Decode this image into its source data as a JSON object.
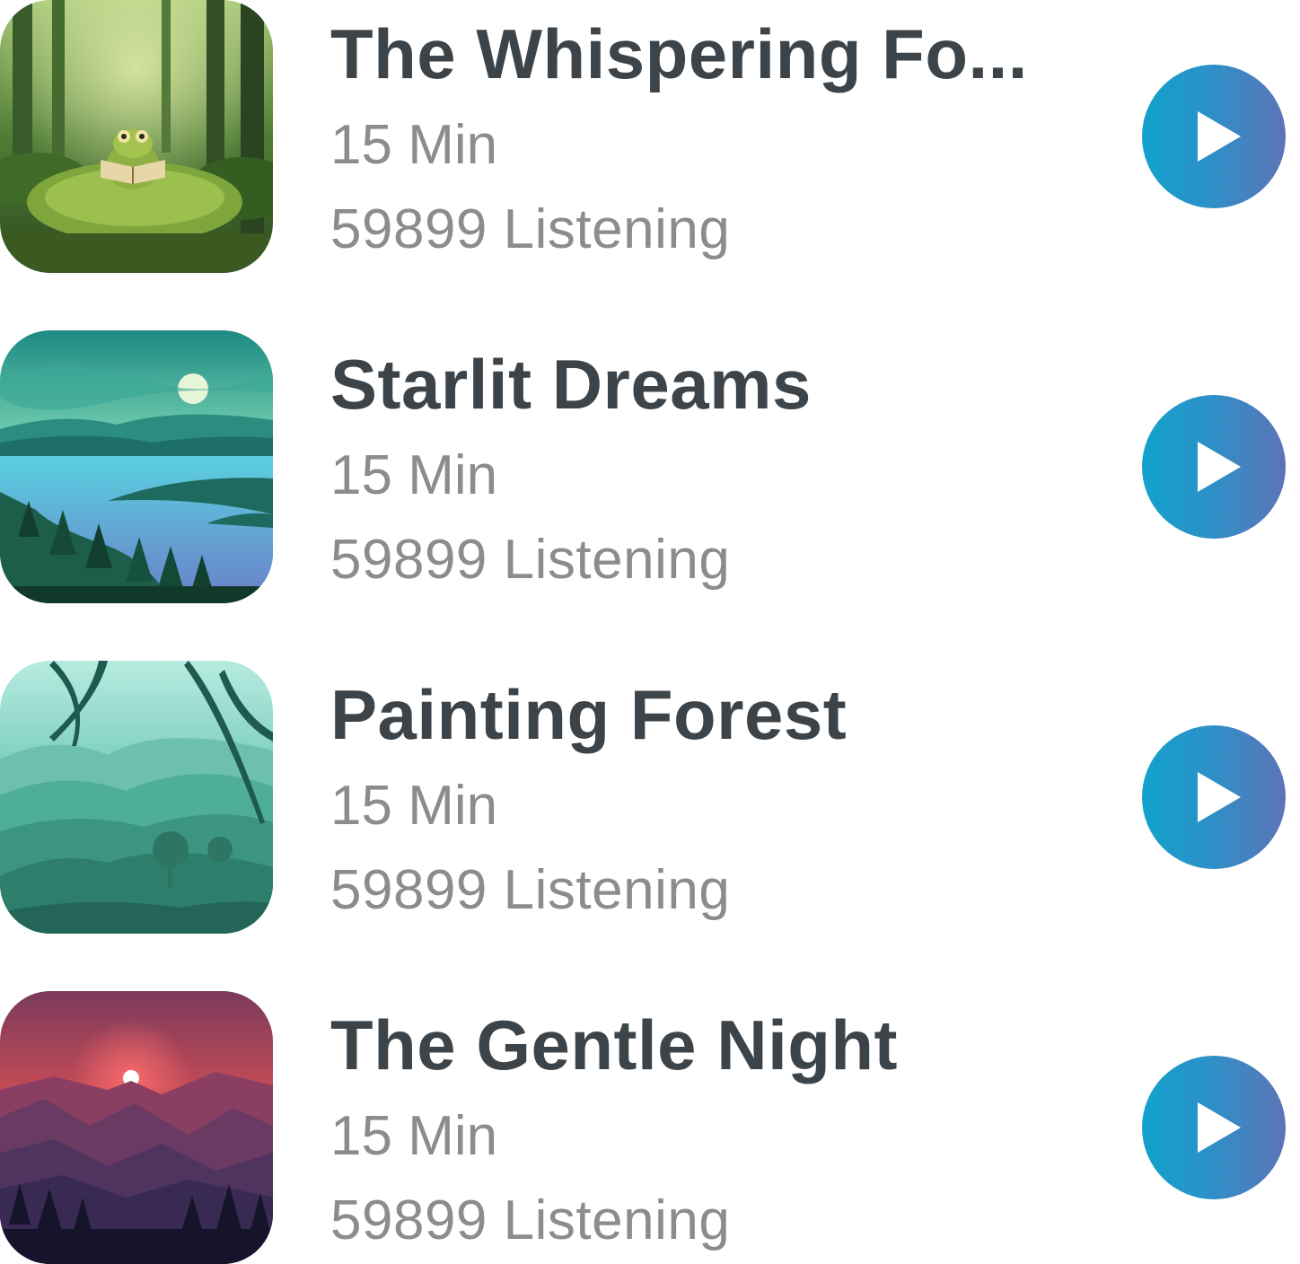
{
  "tracks": [
    {
      "title": "The Whispering Fo...",
      "duration": "15 Min",
      "listeners": "59899 Listening",
      "artwork_icon": "frog-reading-forest-artwork",
      "play_icon": "play-icon"
    },
    {
      "title": "Starlit Dreams",
      "duration": "15 Min",
      "listeners": "59899 Listening",
      "artwork_icon": "moonlit-lake-artwork",
      "play_icon": "play-icon"
    },
    {
      "title": "Painting Forest",
      "duration": "15 Min",
      "listeners": "59899 Listening",
      "artwork_icon": "misty-jungle-artwork",
      "play_icon": "play-icon"
    },
    {
      "title": "The Gentle Night",
      "duration": "15 Min",
      "listeners": "59899 Listening",
      "artwork_icon": "sunset-mountains-artwork",
      "play_icon": "play-icon"
    }
  ],
  "colors": {
    "title": "#3d4449",
    "meta": "#8c8c8c",
    "play_gradient_start": "#12a2cc",
    "play_gradient_end": "#5d74b8"
  }
}
